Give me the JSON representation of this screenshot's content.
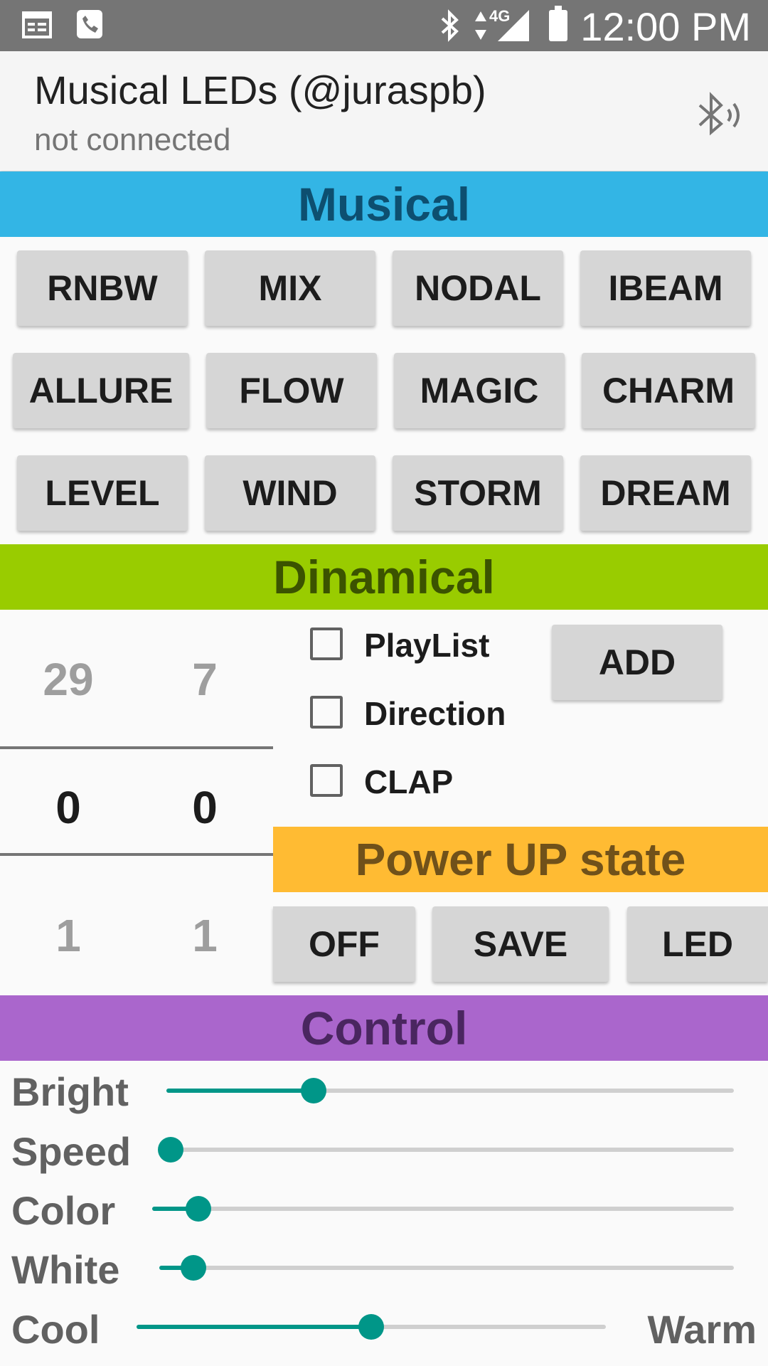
{
  "status_bar": {
    "time": "12:00 PM",
    "network": "4G",
    "icons": [
      "calendar-icon",
      "sip-call-icon",
      "bluetooth-icon",
      "data-transfer-icon",
      "signal-icon",
      "battery-icon"
    ]
  },
  "app_bar": {
    "title": "Musical LEDs (@juraspb)",
    "subtitle": "not connected",
    "action_icon": "bluetooth-searching-icon"
  },
  "musical": {
    "header": "Musical",
    "rows": [
      [
        "RNBW",
        "MIX",
        "NODAL",
        "IBEAM"
      ],
      [
        "ALLURE",
        "FLOW",
        "MAGIC",
        "CHARM"
      ],
      [
        "LEVEL",
        "WIND",
        "STORM",
        "DREAM"
      ]
    ]
  },
  "dinamical": {
    "header": "Dinamical",
    "picker_left": {
      "above": "29",
      "selected": "0",
      "below": "1"
    },
    "picker_right": {
      "above": "7",
      "selected": "0",
      "below": "1"
    },
    "checkboxes": [
      {
        "label": "PlayList",
        "checked": false
      },
      {
        "label": "Direction",
        "checked": false
      },
      {
        "label": "CLAP",
        "checked": false
      }
    ],
    "add_label": "ADD"
  },
  "power_up": {
    "header": "Power UP state",
    "buttons": [
      "OFF",
      "SAVE",
      "LED"
    ]
  },
  "control": {
    "header": "Control",
    "sliders": [
      {
        "label": "Bright",
        "value": 0.26
      },
      {
        "label": "Speed",
        "value": 0.0
      },
      {
        "label": "Color",
        "value": 0.08
      },
      {
        "label": "White",
        "value": 0.06
      },
      {
        "label": "Cool",
        "value": 0.5
      }
    ],
    "cool_right_label": "Warm"
  },
  "colors": {
    "musical": "#33b5e5",
    "dinamical": "#99cc00",
    "power_up": "#ffbb33",
    "control": "#aa66cc",
    "slider_accent": "#009688"
  }
}
